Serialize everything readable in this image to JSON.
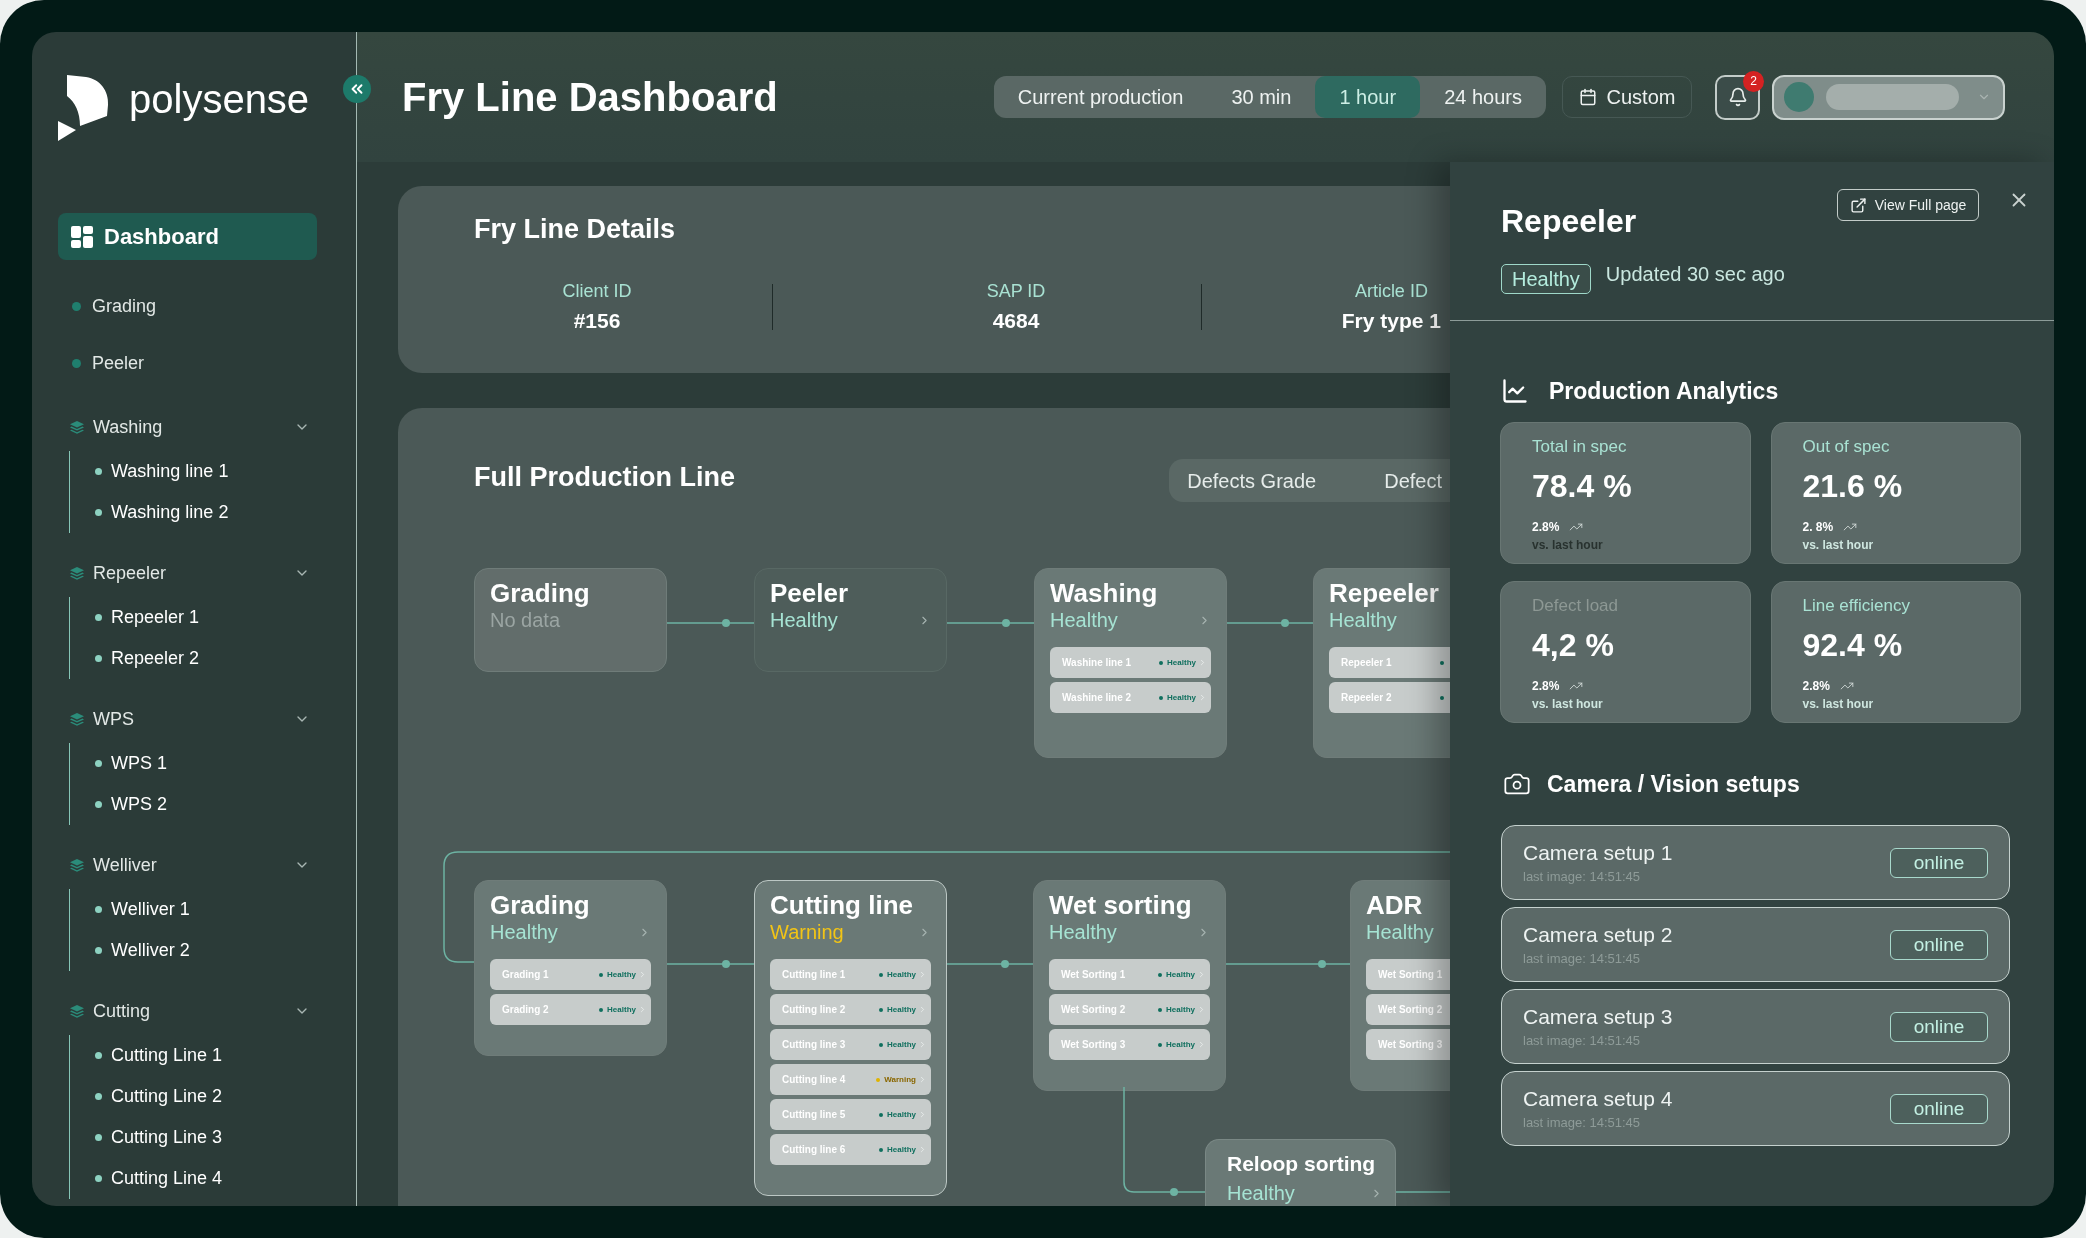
{
  "brand": {
    "name": "polysense"
  },
  "sidebar": {
    "items": [
      {
        "kind": "link",
        "label": "Dashboard",
        "selected": true
      },
      {
        "kind": "item",
        "label": "Grading",
        "selected": false
      },
      {
        "kind": "item",
        "label": "Peeler",
        "selected": false
      },
      {
        "kind": "group",
        "label": "Washing",
        "selected": false,
        "expanded": true,
        "children": [
          {
            "label": "Washing line 1",
            "selected": false
          },
          {
            "label": "Washing line 2",
            "selected": false
          }
        ]
      },
      {
        "kind": "group",
        "label": "Repeeler",
        "selected": false,
        "expanded": true,
        "children": [
          {
            "label": "Repeeler 1",
            "selected": false
          },
          {
            "label": "Repeeler 2",
            "selected": false
          }
        ]
      },
      {
        "kind": "group",
        "label": "WPS",
        "selected": false,
        "expanded": true,
        "children": [
          {
            "label": "WPS 1",
            "selected": false
          },
          {
            "label": "WPS 2",
            "selected": false
          }
        ]
      },
      {
        "kind": "group",
        "label": "Welliver",
        "selected": false,
        "expanded": true,
        "children": [
          {
            "label": "Welliver 1",
            "selected": false
          },
          {
            "label": "Welliver 2",
            "selected": false
          }
        ]
      },
      {
        "kind": "group",
        "label": "Cutting",
        "selected": false,
        "expanded": true,
        "children": [
          {
            "label": "Cutting Line 1",
            "selected": false
          },
          {
            "label": "Cutting Line 2",
            "selected": false
          },
          {
            "label": "Cutting Line 3",
            "selected": false
          },
          {
            "label": "Cutting Line 4",
            "selected": false
          }
        ]
      }
    ]
  },
  "header": {
    "title": "Fry Line Dashboard",
    "time_ranges": [
      {
        "label": "Current production",
        "selected": false
      },
      {
        "label": "30 min",
        "selected": false
      },
      {
        "label": "1 hour",
        "selected": true
      },
      {
        "label": "24 hours",
        "selected": false
      }
    ],
    "custom_button": "Custom",
    "notifications": {
      "count": "2"
    }
  },
  "details": {
    "title": "Fry Line Details",
    "fields": [
      {
        "label": "Client ID",
        "value": "#156"
      },
      {
        "label": "SAP ID",
        "value": "4684"
      },
      {
        "label": "Article ID",
        "value": "Fry type 1"
      }
    ]
  },
  "production_line": {
    "title": "Full Production Line",
    "tabs": [
      {
        "label": "Defects Grade",
        "selected": false
      },
      {
        "label": "Defect",
        "selected": false
      }
    ],
    "rows": [
      {
        "nodes": [
          {
            "title": "Grading",
            "kind": "nodata",
            "status_label": "No data",
            "dimmed": false,
            "selected": false
          },
          {
            "title": "Peeler",
            "kind": "healthy",
            "status_label": "Healthy",
            "dimmed": true,
            "selected": false
          },
          {
            "title": "Washing",
            "kind": "healthy",
            "status_label": "Healthy",
            "dimmed": false,
            "selected": false,
            "items": [
              {
                "label": "Washine line 1",
                "kind": "healthy",
                "status_label": "Healthy"
              },
              {
                "label": "Washine line 2",
                "kind": "healthy",
                "status_label": "Healthy"
              }
            ]
          },
          {
            "title": "Repeeler",
            "kind": "healthy",
            "status_label": "Healthy",
            "dimmed": false,
            "selected": false,
            "items": [
              {
                "label": "Repeeler 1",
                "kind": "healthy"
              },
              {
                "label": "Repeeler 2",
                "kind": "healthy"
              }
            ]
          }
        ]
      },
      {
        "nodes": [
          {
            "title": "Grading",
            "kind": "healthy",
            "status_label": "Healthy",
            "dimmed": false,
            "selected": false,
            "items": [
              {
                "label": "Grading 1",
                "kind": "healthy",
                "status_label": "Healthy"
              },
              {
                "label": "Grading 2",
                "kind": "healthy",
                "status_label": "Healthy"
              }
            ]
          },
          {
            "title": "Cutting line",
            "kind": "warning",
            "status_label": "Warning",
            "dimmed": false,
            "selected": true,
            "items": [
              {
                "label": "Cutting line 1",
                "kind": "healthy",
                "status_label": "Healthy"
              },
              {
                "label": "Cutting line 2",
                "kind": "healthy",
                "status_label": "Healthy"
              },
              {
                "label": "Cutting line 3",
                "kind": "healthy",
                "status_label": "Healthy"
              },
              {
                "label": "Cutting line 4",
                "kind": "warning",
                "status_label": "Warning"
              },
              {
                "label": "Cutting line 5",
                "kind": "healthy",
                "status_label": "Healthy"
              },
              {
                "label": "Cutting line 6",
                "kind": "healthy",
                "status_label": "Healthy"
              }
            ]
          },
          {
            "title": "Wet sorting",
            "kind": "healthy",
            "status_label": "Healthy",
            "dimmed": false,
            "selected": false,
            "items": [
              {
                "label": "Wet Sorting 1",
                "kind": "healthy",
                "status_label": "Healthy"
              },
              {
                "label": "Wet Sorting 2",
                "kind": "healthy",
                "status_label": "Healthy"
              },
              {
                "label": "Wet Sorting 3",
                "kind": "healthy",
                "status_label": "Healthy"
              }
            ]
          },
          {
            "title": "ADR",
            "kind": "healthy",
            "status_label": "Healthy",
            "dimmed": false,
            "selected": false,
            "items": [
              {
                "label": "Wet Sorting 1"
              },
              {
                "label": "Wet Sorting 2"
              },
              {
                "label": "Wet Sorting 3"
              }
            ]
          }
        ]
      }
    ],
    "reloop": {
      "title": "Reloop sorting",
      "kind": "healthy",
      "status_label": "Healthy",
      "dimmed": false,
      "selected": false
    }
  },
  "panel": {
    "title": "Repeeler",
    "view_button": "View Full page",
    "badge": {
      "kind": "healthy",
      "label": "Healthy"
    },
    "updated": "Updated 30 sec ago",
    "analytics": {
      "title": "Production Analytics",
      "stats": [
        {
          "label": "Total in spec",
          "value": "78.4 %",
          "delta": "2.8%",
          "note": "vs. last hour",
          "label_faded": false,
          "note_faded": true
        },
        {
          "label": "Out of spec",
          "value": "21.6 %",
          "delta": "2. 8%",
          "note": "vs. last hour",
          "label_faded": false,
          "note_faded": false
        },
        {
          "label": "Defect load",
          "value": "4,2 %",
          "delta": "2.8%",
          "note": "vs. last hour",
          "label_faded": true,
          "note_faded": false
        },
        {
          "label": "Line efficiency",
          "value": "92.4 %",
          "delta": "2.8%",
          "note": "vs. last hour",
          "label_faded": false,
          "note_faded": false
        }
      ]
    },
    "cameras": {
      "title": "Camera / Vision setups",
      "items": [
        {
          "name": "Camera setup 1",
          "last_image": "last image: 14:51:45",
          "status": "online"
        },
        {
          "name": "Camera setup 2",
          "last_image": "last image: 14:51:45",
          "status": "online"
        },
        {
          "name": "Camera setup 3",
          "last_image": "last image: 14:51:45",
          "status": "online"
        },
        {
          "name": "Camera setup 4",
          "last_image": "last image: 14:51:45",
          "status": "online"
        }
      ]
    }
  }
}
